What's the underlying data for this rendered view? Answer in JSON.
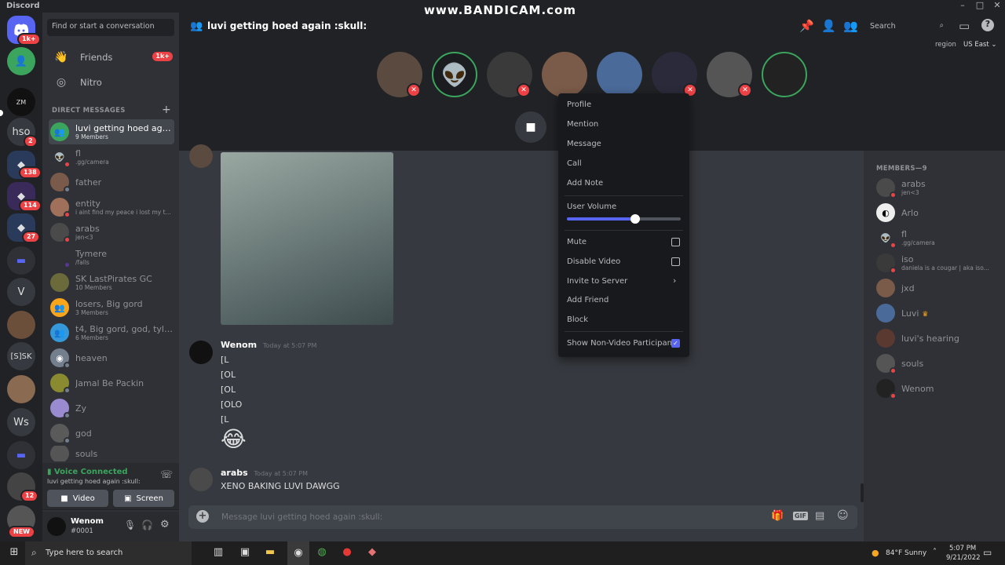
{
  "app": {
    "name": "Discord",
    "watermark": "www.BANDICAM.com"
  },
  "guilds": {
    "home_badge": "1k+",
    "items": [
      "hso",
      "V",
      "[S]SK",
      "Ws"
    ],
    "badges": [
      "2",
      "138",
      "114",
      "27",
      "12"
    ],
    "new_label": "NEW"
  },
  "sidebar": {
    "search_placeholder": "Find or start a conversation",
    "friends": "Friends",
    "friends_badge": "1k+",
    "nitro": "Nitro",
    "dm_header": "DIRECT MESSAGES",
    "dms": [
      {
        "name": "luvi getting hoed again...",
        "sub": "9 Members"
      },
      {
        "name": "fl",
        "sub": ".gg/camera"
      },
      {
        "name": "father",
        "sub": ""
      },
      {
        "name": "entity",
        "sub": "i aint find my peace i lost my t..."
      },
      {
        "name": "arabs",
        "sub": "jen<3"
      },
      {
        "name": "Tymere",
        "sub": "/falls"
      },
      {
        "name": "SK LastPirates GC",
        "sub": "10 Members"
      },
      {
        "name": "losers, Big gord",
        "sub": "3 Members"
      },
      {
        "name": "t4, Big gord, god, tyler...",
        "sub": "6 Members"
      },
      {
        "name": "heaven",
        "sub": ""
      },
      {
        "name": "Jamal Be Packin",
        "sub": ""
      },
      {
        "name": "Zy",
        "sub": ""
      },
      {
        "name": "god",
        "sub": ""
      },
      {
        "name": "souls",
        "sub": ""
      }
    ]
  },
  "voice": {
    "status": "Voice Connected",
    "channel": "luvi getting hoed again :skull:",
    "video": "Video",
    "screen": "Screen"
  },
  "user": {
    "name": "Wenom",
    "tag": "#0001"
  },
  "header": {
    "channel": "luvi getting hoed again :skull:",
    "search": "Search",
    "region_label": "region",
    "region_value": "US East"
  },
  "messages": [
    {
      "author": "Wenom",
      "time": "Today at 5:07 PM",
      "lines": [
        "[L",
        "[OL",
        "[OL",
        "[OLO",
        "[L"
      ]
    },
    {
      "author": "arabs",
      "time": "Today at 5:07 PM",
      "lines": [
        "XENO BAKING LUVI DAWGG"
      ]
    }
  ],
  "composer": {
    "placeholder": "Message luvi getting hoed again :skull:"
  },
  "members": {
    "header": "MEMBERS—9",
    "list": [
      {
        "name": "arabs",
        "sub": "jen<3"
      },
      {
        "name": "Arlo",
        "sub": ""
      },
      {
        "name": "fl",
        "sub": ".gg/camera"
      },
      {
        "name": "iso",
        "sub": "daniela is a cougar | aka iso..."
      },
      {
        "name": "jxd",
        "sub": ""
      },
      {
        "name": "Luvi",
        "sub": ""
      },
      {
        "name": "luvi's hearing",
        "sub": ""
      },
      {
        "name": "souls",
        "sub": ""
      },
      {
        "name": "Wenom",
        "sub": ""
      }
    ]
  },
  "context_menu": {
    "items": [
      "Profile",
      "Mention",
      "Message",
      "Call",
      "Add Note"
    ],
    "volume_label": "User Volume",
    "volume_level": 0.6,
    "mute": "Mute",
    "disable_video": "Disable Video",
    "invite": "Invite to Server",
    "add_friend": "Add Friend",
    "block": "Block",
    "show_nonvideo": "Show Non-Video Participants"
  },
  "taskbar": {
    "search": "Type here to search",
    "weather": "84°F  Sunny",
    "time": "5:07 PM",
    "date": "9/21/2022"
  },
  "colors": {
    "blurple": "#5865f2",
    "red": "#ed4245",
    "green": "#3ba55d"
  }
}
